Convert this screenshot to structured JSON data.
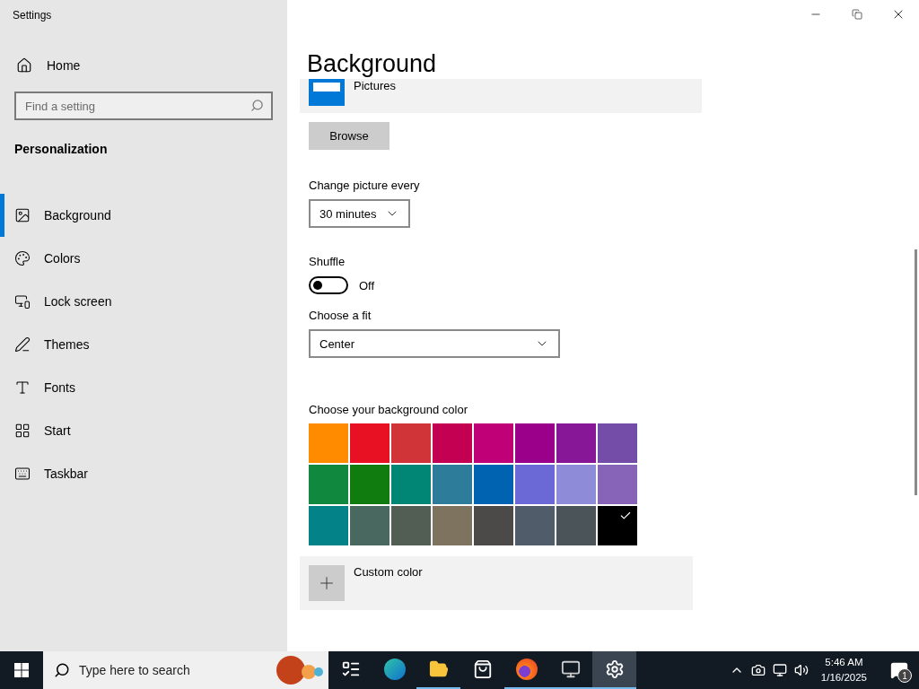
{
  "window": {
    "title": "Settings"
  },
  "sidebar": {
    "home": "Home",
    "search": {
      "placeholder": "Find a setting"
    },
    "section": "Personalization",
    "items": [
      {
        "label": "Background",
        "selected": true
      },
      {
        "label": "Colors",
        "selected": false
      },
      {
        "label": "Lock screen",
        "selected": false
      },
      {
        "label": "Themes",
        "selected": false
      },
      {
        "label": "Fonts",
        "selected": false
      },
      {
        "label": "Start",
        "selected": false
      },
      {
        "label": "Taskbar",
        "selected": false
      }
    ]
  },
  "main": {
    "title": "Background",
    "folder": {
      "label": "Pictures"
    },
    "browse_button": "Browse",
    "change_picture": {
      "label": "Change picture every",
      "value": "30 minutes"
    },
    "shuffle": {
      "label": "Shuffle",
      "on": false,
      "state_text": "Off"
    },
    "fit": {
      "label": "Choose a fit",
      "value": "Center"
    },
    "color_picker": {
      "label": "Choose your background color",
      "swatches": [
        {
          "color": "#ff8c00",
          "selected": false
        },
        {
          "color": "#e81123",
          "selected": false
        },
        {
          "color": "#d13438",
          "selected": false
        },
        {
          "color": "#c30052",
          "selected": false
        },
        {
          "color": "#bf0077",
          "selected": false
        },
        {
          "color": "#9a0089",
          "selected": false
        },
        {
          "color": "#881798",
          "selected": false
        },
        {
          "color": "#744da9",
          "selected": false
        },
        {
          "color": "#10893e",
          "selected": false
        },
        {
          "color": "#107c10",
          "selected": false
        },
        {
          "color": "#018574",
          "selected": false
        },
        {
          "color": "#2d7d9a",
          "selected": false
        },
        {
          "color": "#0063b1",
          "selected": false
        },
        {
          "color": "#6b69d6",
          "selected": false
        },
        {
          "color": "#8e8cd8",
          "selected": false
        },
        {
          "color": "#8764b8",
          "selected": false
        },
        {
          "color": "#038387",
          "selected": false
        },
        {
          "color": "#486860",
          "selected": false
        },
        {
          "color": "#525e54",
          "selected": false
        },
        {
          "color": "#7e735f",
          "selected": false
        },
        {
          "color": "#4c4a48",
          "selected": false
        },
        {
          "color": "#515c6b",
          "selected": false
        },
        {
          "color": "#4a5459",
          "selected": false
        },
        {
          "color": "#000000",
          "selected": true
        }
      ]
    },
    "custom_color": {
      "label": "Custom color"
    }
  },
  "taskbar": {
    "search": {
      "placeholder": "Type here to search"
    },
    "apps": [
      {
        "open": false,
        "selected": false
      },
      {
        "open": false,
        "selected": false
      },
      {
        "open": true,
        "selected": false
      },
      {
        "open": false,
        "selected": false
      },
      {
        "open": true,
        "selected": false
      },
      {
        "open": true,
        "selected": false
      },
      {
        "open": true,
        "selected": true
      }
    ],
    "clock": {
      "time": "5:46 AM",
      "date": "1/16/2025"
    },
    "notifications": {
      "count": "1"
    }
  }
}
